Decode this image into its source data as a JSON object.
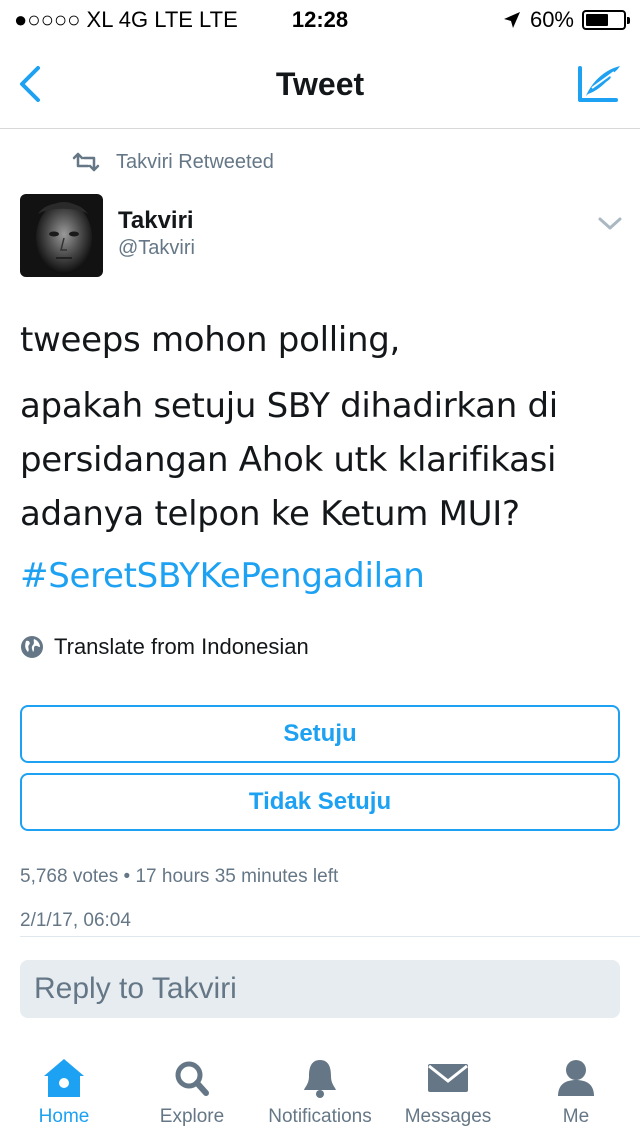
{
  "status_bar": {
    "carrier": "●○○○○ XL 4G LTE   LTE",
    "time": "12:28",
    "battery": "60%",
    "battery_level": 0.6
  },
  "nav": {
    "title": "Tweet"
  },
  "tweet": {
    "retweeted_by": "Takviri Retweeted",
    "author_name": "Takviri",
    "author_handle": "@Takviri",
    "text_lines": [
      "tweeps mohon polling,",
      "apakah setuju SBY dihadirkan di",
      "persidangan Ahok utk klarifikasi",
      "adanya telpon ke Ketum MUI?"
    ],
    "hashtag": "#SeretSBYKePengadilan",
    "translate": "Translate from Indonesian",
    "poll": {
      "options": [
        "Setuju",
        "Tidak Setuju"
      ],
      "votes": "5,768 votes",
      "separator": "•",
      "time_left": "17 hours 35 minutes left"
    },
    "timestamp": "2/1/17, 06:04"
  },
  "reply": {
    "placeholder": "Reply to Takviri"
  },
  "tabs": [
    {
      "label": "Home",
      "icon": "home-icon",
      "active": true
    },
    {
      "label": "Explore",
      "icon": "search-icon",
      "active": false
    },
    {
      "label": "Notifications",
      "icon": "bell-icon",
      "active": false
    },
    {
      "label": "Messages",
      "icon": "envelope-icon",
      "active": false
    },
    {
      "label": "Me",
      "icon": "person-icon",
      "active": false
    }
  ],
  "colors": {
    "accent": "#1da1f2",
    "secondary_text": "#657786",
    "primary_text": "#14171a",
    "reply_bg": "#e6ecf0"
  }
}
